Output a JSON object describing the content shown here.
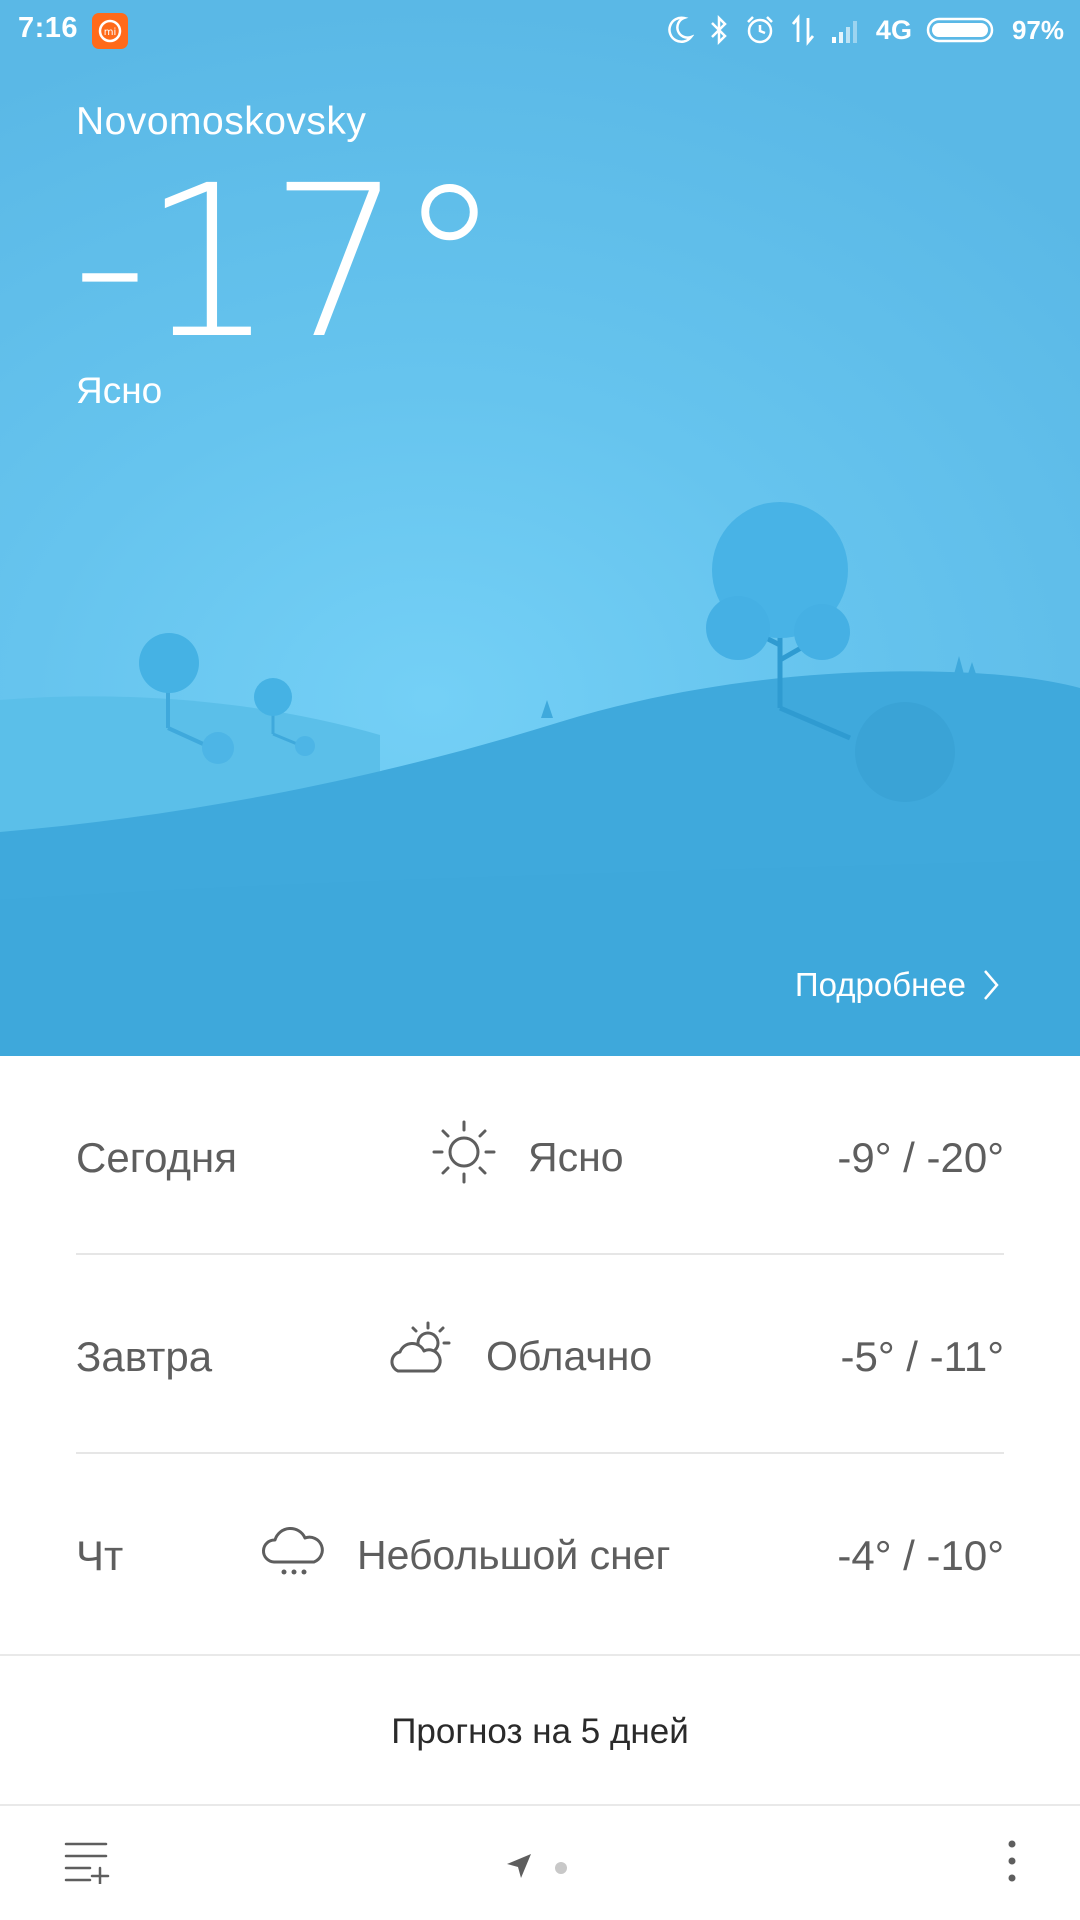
{
  "status_bar": {
    "time": "7:16",
    "network": "4G",
    "battery": "97%",
    "icons": [
      "mi-app-icon",
      "moon-icon",
      "bluetooth-icon",
      "alarm-icon",
      "data-transfer-icon",
      "signal-icon",
      "battery-icon"
    ]
  },
  "current": {
    "city": "Novomoskovsky",
    "temperature": "-17°",
    "condition": "Ясно",
    "details_label": "Подробнее"
  },
  "forecast": [
    {
      "day": "Сегодня",
      "icon": "sun-icon",
      "condition": "Ясно",
      "range": "-9° / -20°"
    },
    {
      "day": "Завтра",
      "icon": "partly-cloudy-icon",
      "condition": "Облачно",
      "range": "-5° / -11°"
    },
    {
      "day": "Чт",
      "icon": "snow-cloud-icon",
      "condition": "Небольшой снег",
      "range": "-4° / -10°"
    }
  ],
  "five_day_label": "Прогноз на 5 дней",
  "bottom_nav": {
    "icons": [
      "add-city-list-icon",
      "location-arrow-icon",
      "page-indicator-dot",
      "more-vertical-icon"
    ]
  },
  "colors": {
    "sky_light": "#74d0f6",
    "sky": "#5ab8e6",
    "hill_back": "#5bbfe9",
    "hill_front": "#3fa9dc",
    "tree": "#45b2e4",
    "text_gray": "#5e5e5e",
    "mi_orange": "#ff6a1a"
  }
}
